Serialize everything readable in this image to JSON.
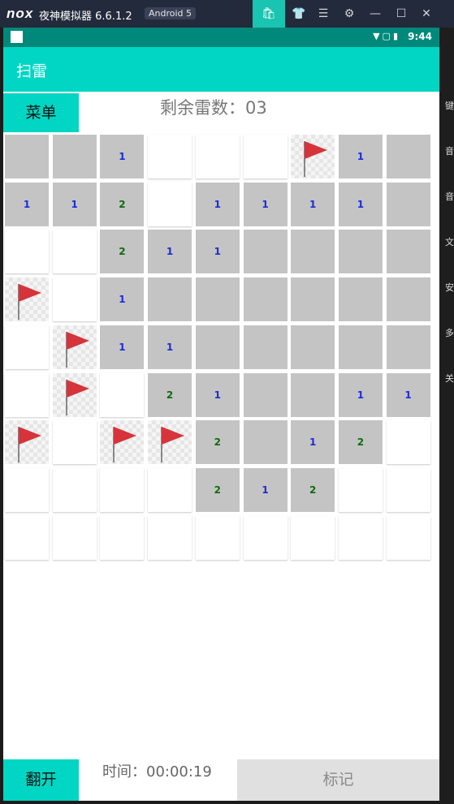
{
  "emulator": {
    "logo": "nox",
    "title": "夜神模拟器 6.6.1.2",
    "android_badge": "Android 5",
    "controls": [
      "store-icon",
      "shirt-icon",
      "menu-icon",
      "gear-icon",
      "minimize-icon",
      "maximize-icon",
      "close-icon"
    ],
    "sidebar_labels": [
      "键",
      "音",
      "音",
      "文",
      "安",
      "多",
      "关"
    ]
  },
  "status_bar": {
    "time": "9:44",
    "icons": [
      "wifi-icon",
      "no-sim-icon",
      "battery-icon"
    ]
  },
  "app_bar": {
    "title": "扫雷"
  },
  "top": {
    "menu_label": "菜单",
    "mines_remaining": "剩余雷数：03"
  },
  "board": {
    "cols": 9,
    "rows": [
      [
        "C",
        "C",
        "1",
        "O",
        "O",
        "O",
        "F",
        "1",
        "C"
      ],
      [
        "1",
        "1",
        "2",
        "O",
        "1",
        "1",
        "1",
        "1",
        "C"
      ],
      [
        "O",
        "O",
        "2",
        "1",
        "1",
        "C",
        "C",
        "C",
        "C"
      ],
      [
        "F",
        "O",
        "1",
        "C",
        "C",
        "C",
        "C",
        "C",
        "C"
      ],
      [
        "O",
        "F",
        "1",
        "1",
        "C",
        "C",
        "C",
        "C",
        "C"
      ],
      [
        "O",
        "F",
        "O",
        "2",
        "1",
        "C",
        "C",
        "1",
        "1"
      ],
      [
        "F",
        "O",
        "F",
        "F",
        "2",
        "C",
        "1",
        "2",
        "O"
      ],
      [
        "O",
        "O",
        "O",
        "O",
        "2",
        "1",
        "2",
        "O",
        "O"
      ],
      [
        "O",
        "O",
        "O",
        "O",
        "O",
        "O",
        "O",
        "O",
        "O"
      ]
    ],
    "legend": {
      "C": "closed",
      "O": "open",
      "F": "flag"
    },
    "number_colors": {
      "1": "#1e2bd8",
      "2": "#0f6b0f",
      "3": "#c01b1b"
    },
    "flag_color": "#d6343a"
  },
  "bottom": {
    "flip_label": "翻开",
    "timer": "时间：00:00:19",
    "mark_label": "标记"
  },
  "colors": {
    "accent": "#00d6c3",
    "status_bar": "#00897b",
    "closed_cell": "#c4c4c4"
  }
}
